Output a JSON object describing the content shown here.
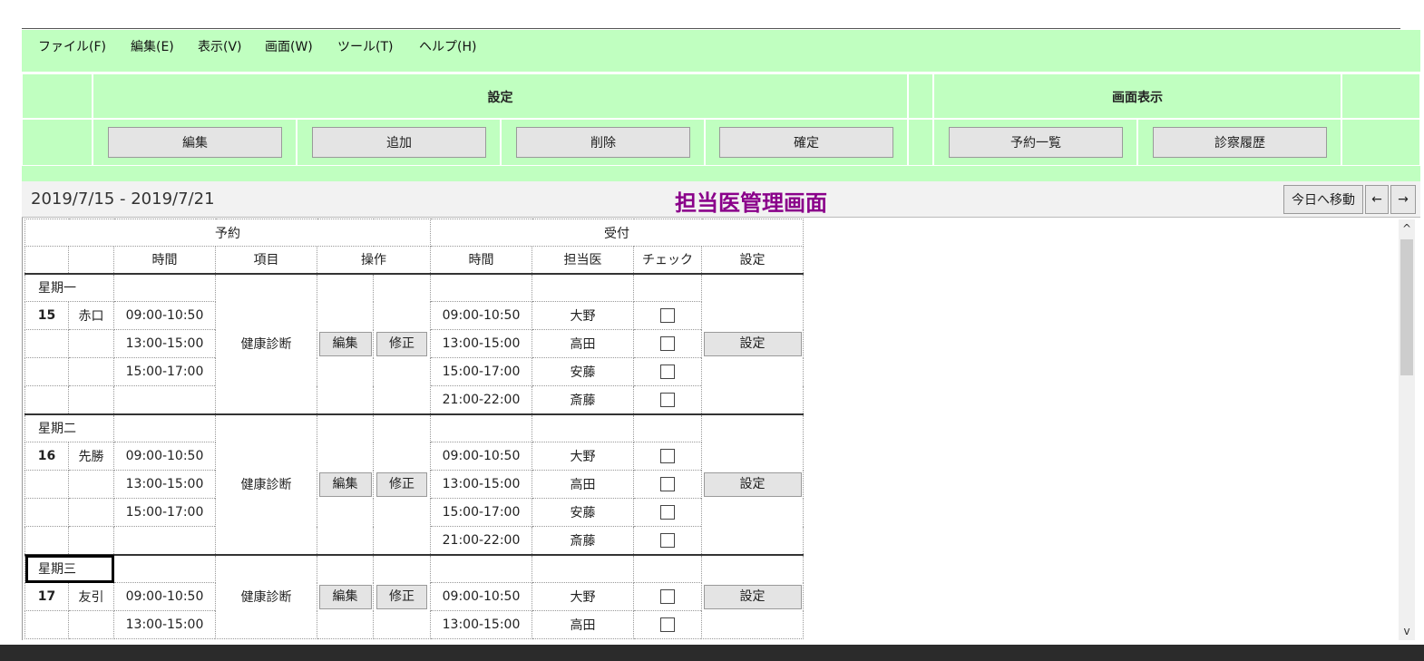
{
  "menu": [
    "ファイル(F)",
    "編集(E)",
    "表示(V)",
    "画面(W)",
    "ツール(T)",
    "ヘルプ(H)"
  ],
  "ribbon": {
    "settings_group": "設定",
    "display_group": "画面表示",
    "buttons": {
      "edit": "編集",
      "add": "追加",
      "delete": "削除",
      "confirm": "確定",
      "reservation_list": "予約一覧",
      "exam_history": "診察履歴"
    }
  },
  "header": {
    "date_range": "2019/7/15 - 2019/7/21",
    "title": "担当医管理画面",
    "today_button": "今日へ移動",
    "prev_icon": "arrow-left-icon",
    "next_icon": "arrow-right-icon",
    "prev_symbol": "←",
    "next_symbol": "→"
  },
  "table": {
    "group_reservation": "予約",
    "group_reception": "受付",
    "col_time": "時間",
    "col_item": "項目",
    "col_ops": "操作",
    "col_recv_time": "時間",
    "col_doctor": "担当医",
    "col_check": "チェック",
    "col_settings": "設定",
    "days": [
      {
        "name": "星期一",
        "num": "15",
        "rokuyo": "赤口",
        "item": "健康診断",
        "res_times": [
          "09:00-10:50",
          "13:00-15:00",
          "15:00-17:00",
          ""
        ],
        "reception": [
          {
            "time": "09:00-10:50",
            "doctor": "大野"
          },
          {
            "time": "13:00-15:00",
            "doctor": "高田"
          },
          {
            "time": "15:00-17:00",
            "doctor": "安藤"
          },
          {
            "time": "21:00-22:00",
            "doctor": "斎藤"
          }
        ],
        "edit_label": "編集",
        "fix_label": "修正",
        "settings_label": "設定"
      },
      {
        "name": "星期二",
        "num": "16",
        "rokuyo": "先勝",
        "item": "健康診断",
        "res_times": [
          "09:00-10:50",
          "13:00-15:00",
          "15:00-17:00",
          ""
        ],
        "reception": [
          {
            "time": "09:00-10:50",
            "doctor": "大野"
          },
          {
            "time": "13:00-15:00",
            "doctor": "高田"
          },
          {
            "time": "15:00-17:00",
            "doctor": "安藤"
          },
          {
            "time": "21:00-22:00",
            "doctor": "斎藤"
          }
        ],
        "edit_label": "編集",
        "fix_label": "修正",
        "settings_label": "設定"
      },
      {
        "name": "星期三",
        "num": "17",
        "rokuyo": "友引",
        "item": "健康診断",
        "res_times": [
          "09:00-10:50",
          "13:00-15:00"
        ],
        "reception": [
          {
            "time": "09:00-10:50",
            "doctor": "大野"
          },
          {
            "time": "13:00-15:00",
            "doctor": "高田"
          }
        ],
        "edit_label": "編集",
        "fix_label": "修正",
        "settings_label": "設定"
      }
    ]
  },
  "scroll_up_symbol": "^",
  "scroll_down_symbol": "v",
  "colors": {
    "ribbon_bg": "#c0ffc0",
    "title": "#8a008a"
  }
}
